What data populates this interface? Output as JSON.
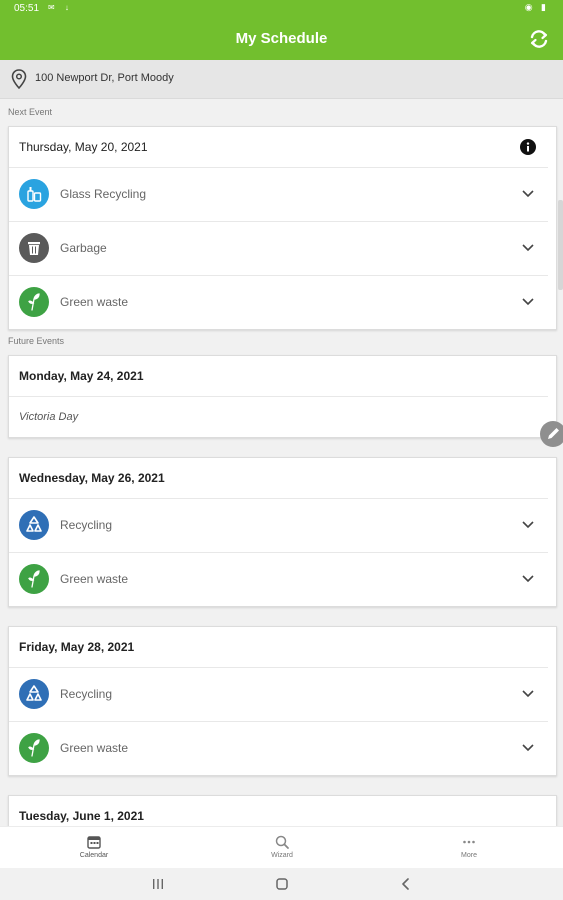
{
  "status_bar": {
    "time": "05:51"
  },
  "app_bar": {
    "title": "My Schedule",
    "refresh_icon": "refresh-icon"
  },
  "address": {
    "text": "100 Newport Dr, Port Moody",
    "icon": "location-pin-icon"
  },
  "next_event": {
    "section_label": "Next Event",
    "date": "Thursday, May 20, 2021",
    "items": [
      {
        "label": "Glass Recycling",
        "icon": "glass-recycling-icon",
        "color": "#2aa3e0"
      },
      {
        "label": "Garbage",
        "icon": "garbage-icon",
        "color": "#5a5a5a"
      },
      {
        "label": "Green waste",
        "icon": "green-waste-icon",
        "color": "#3ea244"
      }
    ]
  },
  "future_events": {
    "section_label": "Future Events",
    "events": [
      {
        "date": "Monday, May 24, 2021",
        "holiday": "Victoria Day"
      },
      {
        "date": "Wednesday, May 26, 2021",
        "items": [
          {
            "label": "Recycling",
            "icon": "recycling-icon",
            "color": "#2f6fb6"
          },
          {
            "label": "Green waste",
            "icon": "green-waste-icon",
            "color": "#3ea244"
          }
        ]
      },
      {
        "date": "Friday, May 28, 2021",
        "items": [
          {
            "label": "Recycling",
            "icon": "recycling-icon",
            "color": "#2f6fb6"
          },
          {
            "label": "Green waste",
            "icon": "green-waste-icon",
            "color": "#3ea244"
          }
        ]
      },
      {
        "date": "Tuesday, June 1, 2021"
      }
    ]
  },
  "bottom_nav": {
    "tabs": [
      {
        "label": "Calendar",
        "icon": "calendar-icon"
      },
      {
        "label": "Wizard",
        "icon": "wizard-search-icon"
      },
      {
        "label": "More",
        "icon": "more-icon"
      }
    ]
  },
  "colors": {
    "brand_green": "#72bf2e"
  }
}
